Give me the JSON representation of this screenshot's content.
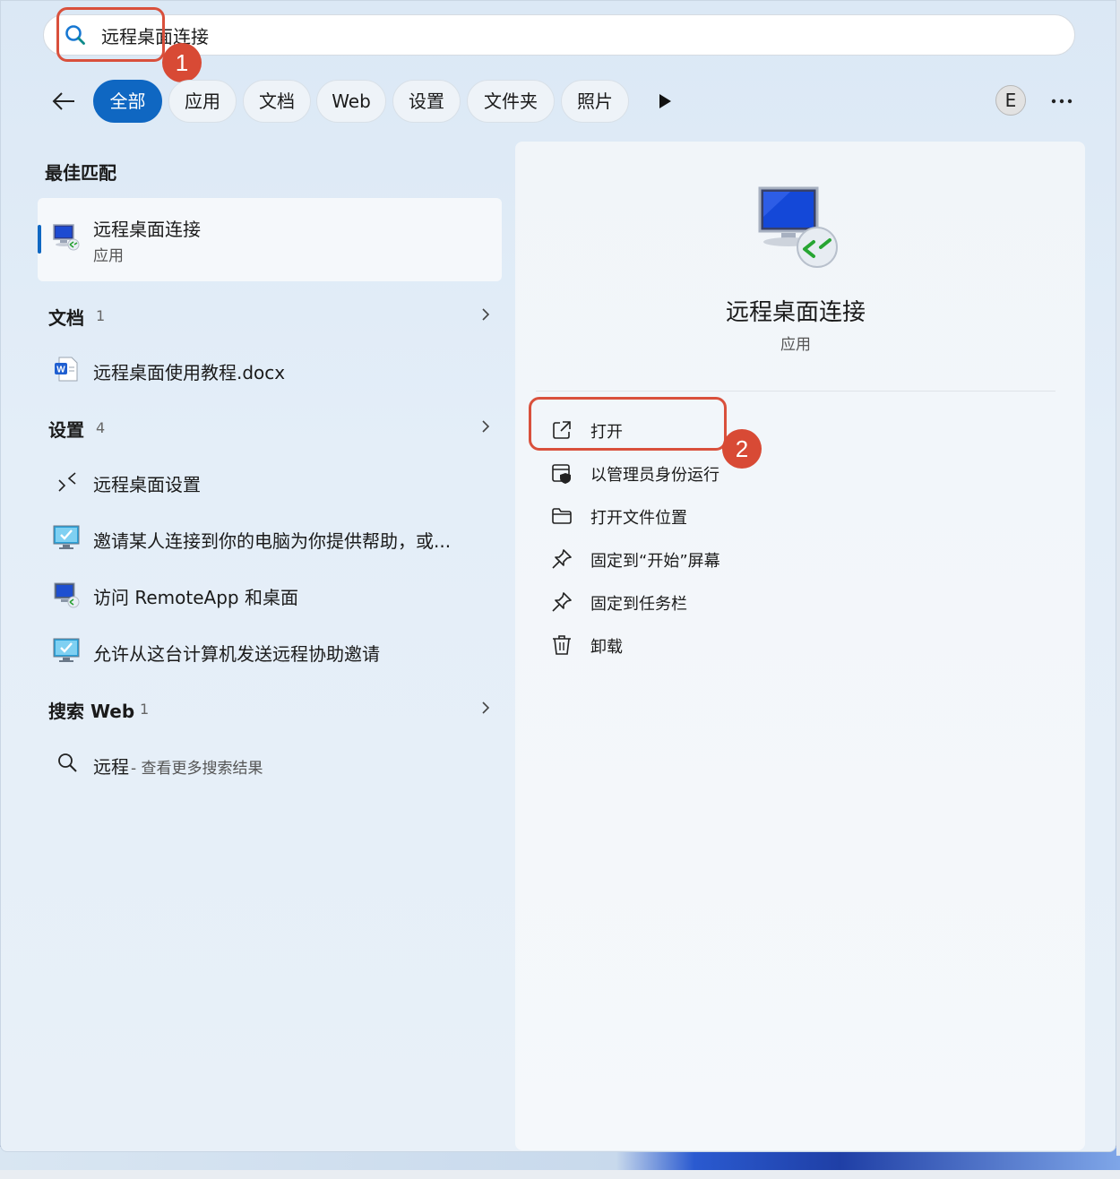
{
  "search": {
    "query": "远程桌面连接"
  },
  "annotations": [
    {
      "number": "1"
    },
    {
      "number": "2"
    }
  ],
  "filters": [
    "全部",
    "应用",
    "文档",
    "Web",
    "设置",
    "文件夹",
    "照片"
  ],
  "account": {
    "initial": "E"
  },
  "best_match": {
    "section_title": "最佳匹配",
    "name": "远程桌面连接",
    "type": "应用"
  },
  "documents": {
    "title": "文档",
    "count": "1",
    "items": [
      "远程桌面使用教程.docx"
    ]
  },
  "settings": {
    "title": "设置",
    "count": "4",
    "items": [
      "远程桌面设置",
      "邀请某人连接到你的电脑为你提供帮助，或...",
      "访问 RemoteApp 和桌面",
      "允许从这台计算机发送远程协助邀请"
    ]
  },
  "web": {
    "title": "搜索 Web",
    "count": "1",
    "query": "远程",
    "suffix": " - 查看更多搜索结果"
  },
  "preview": {
    "title": "远程桌面连接",
    "subtitle": "应用",
    "actions": [
      {
        "label": "打开",
        "icon": "open-external-icon"
      },
      {
        "label": "以管理员身份运行",
        "icon": "admin-shield-icon"
      },
      {
        "label": "打开文件位置",
        "icon": "folder-icon"
      },
      {
        "label": "固定到“开始”屏幕",
        "icon": "pin-icon"
      },
      {
        "label": "固定到任务栏",
        "icon": "pin-icon"
      },
      {
        "label": "卸载",
        "icon": "trash-icon"
      }
    ]
  },
  "colors": {
    "accent": "#0f67c2",
    "annotation": "#d84a35"
  }
}
